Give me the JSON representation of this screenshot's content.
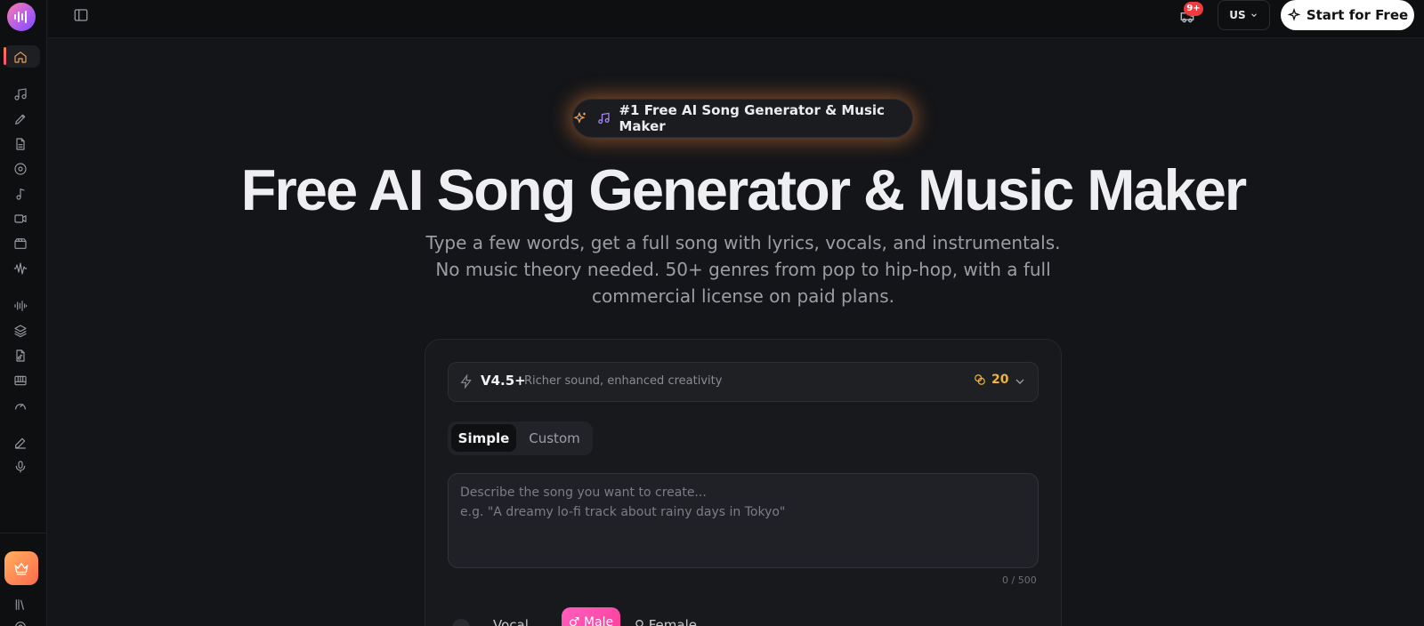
{
  "topbar": {
    "notification_count": "9+",
    "region": "US",
    "start_button": "Start for Free"
  },
  "hero": {
    "pill": "#1 Free AI Song Generator & Music Maker",
    "headline": "Free AI Song Generator & Music Maker",
    "subtitle": "Type a few words, get a full song with lyrics, vocals, and instrumentals. No music theory needed. 50+ genres from pop to hip-hop, with a full commercial license on paid plans."
  },
  "generator": {
    "model_name": "V4.5+",
    "model_desc": "Richer sound, enhanced creativity",
    "credits": "20",
    "tabs": [
      "Simple",
      "Custom"
    ],
    "prompt_placeholder_line1": "Describe the song you want to create...",
    "prompt_placeholder_line2": "e.g. \"A dreamy lo-fi track about rainy days in Tokyo\"",
    "counter": "0 / 500",
    "vocal_label": "Vocal",
    "male_label": "♂ Male",
    "female_label": "♀ Female"
  },
  "colors": {
    "accent_orange": "#f0a35a",
    "credit_gold": "#f0b33a",
    "notif_red": "#ef3b3b",
    "male_pink": "#ff4fae"
  }
}
